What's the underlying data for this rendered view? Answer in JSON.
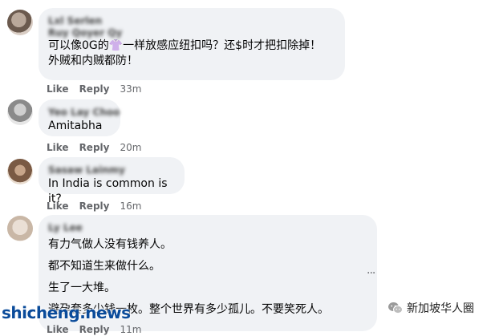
{
  "comments": [
    {
      "author": "Lxl Serlen",
      "author_line2": "Ruy Qoyer Qy",
      "lines": [
        "可以像0G的👚一样放感应纽扣吗？还$时才把扣除掉！",
        "外贼和内贼都防！"
      ],
      "like": "Like",
      "reply": "Reply",
      "time": "33m"
    },
    {
      "author": "Yeo Lay Choo",
      "lines": [
        "Amitabha"
      ],
      "like": "Like",
      "reply": "Reply",
      "time": "20m"
    },
    {
      "author": "Sasaw Lainmy",
      "lines": [
        "In India is common is it?"
      ],
      "like": "Like",
      "reply": "Reply",
      "time": "16m"
    },
    {
      "author": "Ly Lee",
      "lines": [
        "有力气做人没有钱养人。",
        "都不知道生来做什么。",
        "生了一大堆。",
        "避孕套多少钱一枚。整个世界有多少孤儿。不要笑死人。"
      ],
      "like": "Like",
      "reply": "Reply",
      "time": "11m"
    }
  ],
  "more_options": "···",
  "watermark": {
    "left": "shicheng.news",
    "right": "新加坡华人圈"
  }
}
